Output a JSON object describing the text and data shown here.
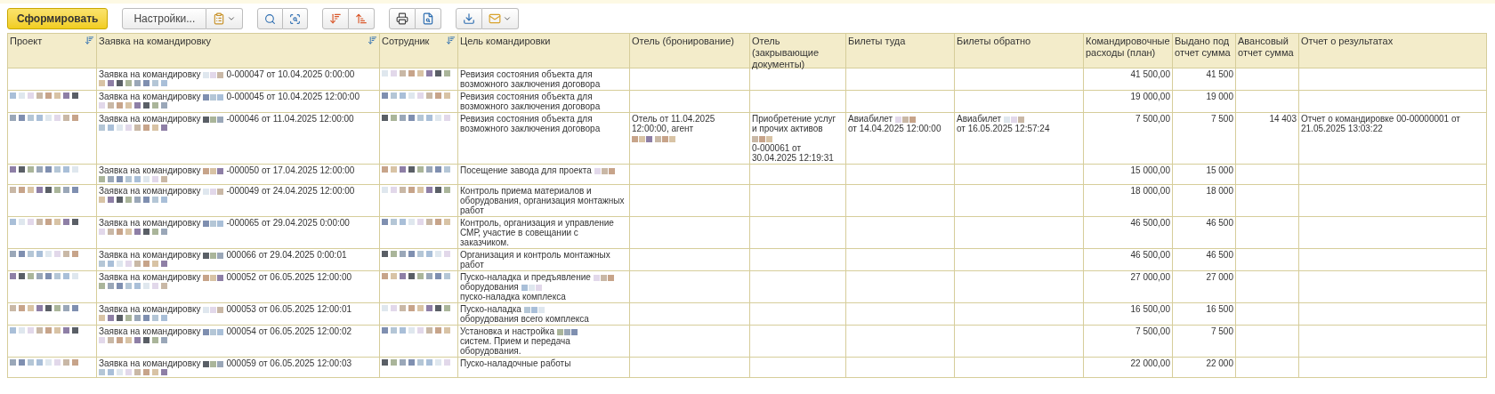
{
  "toolbar": {
    "generate_button": "Сформировать",
    "settings_button": "Настройки..."
  },
  "table": {
    "columns": [
      {
        "label": "Проект",
        "sortable": true
      },
      {
        "label": "Заявка на командировку",
        "sortable": true
      },
      {
        "label": "Сотрудник",
        "sortable": true
      },
      {
        "label": "Цель командировки",
        "sortable": false
      },
      {
        "label": "Отель (бронирование)",
        "sortable": false
      },
      {
        "label": "Отель (закрывающие документы)",
        "sortable": false
      },
      {
        "label": "Билеты туда",
        "sortable": false
      },
      {
        "label": "Билеты обратно",
        "sortable": false
      },
      {
        "label": "Командировочные расходы (план)",
        "sortable": false
      },
      {
        "label": "Выдано под отчет сумма",
        "sortable": false
      },
      {
        "label": "Авансовый отчет сумма",
        "sortable": false
      },
      {
        "label": "Отчет о результатах",
        "sortable": false
      }
    ],
    "rows": [
      {
        "request": [
          "Заявка на командировку",
          {
            "kind": "redacted"
          },
          "0-000047 от 10.04.2025 0:00:00",
          {
            "kind": "redacted_line"
          }
        ],
        "employee": [
          {
            "kind": "redacted_line"
          }
        ],
        "purpose": [
          "Ревизия состояния объекта для возможного заключения договора"
        ],
        "plan": "41 500,00",
        "issued": "41 500"
      },
      {
        "project": [
          {
            "kind": "redacted_line"
          }
        ],
        "request": [
          "Заявка на командировку",
          {
            "kind": "redacted"
          },
          "0-000045 от 10.04.2025 12:00:00",
          {
            "kind": "redacted_line"
          }
        ],
        "employee": [
          {
            "kind": "redacted_line"
          }
        ],
        "purpose": [
          "Ревизия состояния объекта для возможного заключения договора"
        ],
        "plan": "19 000,00",
        "issued": "19 000"
      },
      {
        "project": [
          {
            "kind": "redacted_line"
          }
        ],
        "request": [
          "Заявка на командировку",
          {
            "kind": "redacted"
          },
          "-000046 от 11.04.2025 12:00:00",
          {
            "kind": "redacted_line"
          }
        ],
        "employee": [
          {
            "kind": "redacted_line"
          }
        ],
        "purpose": [
          "Ревизия состояния объекта для возможного заключения договора"
        ],
        "hotel_booking": [
          "Отель  от 11.04.2025 12:00:00, агент",
          {
            "kind": "redacted"
          },
          {
            "kind": "redacted"
          }
        ],
        "hotel_docs": [
          "Приобретение услуг и прочих активов",
          {
            "kind": "redacted"
          },
          "0-000061 от 30.04.2025 12:19:31"
        ],
        "tickets_to": [
          "Авиабилет",
          {
            "kind": "redacted"
          },
          "от 14.04.2025 12:00:00"
        ],
        "tickets_back": [
          "Авиабилет",
          {
            "kind": "redacted"
          },
          "от 16.05.2025 12:57:24"
        ],
        "plan": "7 500,00",
        "issued": "7 500",
        "advance": "14 403",
        "report": [
          "Отчет о командировке 00-00000001 от 21.05.2025 13:03:22"
        ]
      },
      {
        "project": [
          {
            "kind": "redacted_line"
          }
        ],
        "request": [
          "Заявка на командировку",
          {
            "kind": "redacted"
          },
          "-000050 от 17.04.2025 12:00:00",
          {
            "kind": "redacted_line"
          }
        ],
        "employee": [
          {
            "kind": "redacted_line"
          }
        ],
        "purpose": [
          "Посещение завода для проекта",
          {
            "kind": "redacted"
          }
        ],
        "plan": "15 000,00",
        "issued": "15 000"
      },
      {
        "project": [
          {
            "kind": "redacted_line"
          }
        ],
        "request": [
          "Заявка на командировку",
          {
            "kind": "redacted"
          },
          "-000049 от 24.04.2025 12:00:00",
          {
            "kind": "redacted_line"
          }
        ],
        "employee": [
          {
            "kind": "redacted_line"
          }
        ],
        "purpose": [
          "Контроль приема материалов и оборудования, организация монтажных работ"
        ],
        "plan": "18 000,00",
        "issued": "18 000"
      },
      {
        "project": [
          {
            "kind": "redacted_line"
          }
        ],
        "request": [
          "Заявка на командировку",
          {
            "kind": "redacted"
          },
          "-000065 от 29.04.2025 0:00:00",
          {
            "kind": "redacted_line"
          }
        ],
        "employee": [
          {
            "kind": "redacted_line"
          }
        ],
        "purpose": [
          "Контроль, организация и управление СМР, участие в совещании с заказчиком."
        ],
        "plan": "46 500,00",
        "issued": "46 500"
      },
      {
        "project": [
          {
            "kind": "redacted_line"
          }
        ],
        "request": [
          "Заявка на командировку",
          {
            "kind": "redacted"
          },
          "000066 от 29.04.2025 0:00:01",
          {
            "kind": "redacted_line"
          }
        ],
        "employee": [
          {
            "kind": "redacted_line"
          }
        ],
        "purpose": [
          "Организация и контроль монтажных работ"
        ],
        "plan": "46 500,00",
        "issued": "46 500"
      },
      {
        "project": [
          {
            "kind": "redacted_line"
          }
        ],
        "request": [
          "Заявка на командировку",
          {
            "kind": "redacted"
          },
          "000052 от 06.05.2025 12:00:00",
          {
            "kind": "redacted_line"
          }
        ],
        "employee": [
          {
            "kind": "redacted_line"
          }
        ],
        "purpose": [
          "Пуско-наладка и предъявление",
          {
            "kind": "redacted"
          },
          "оборудования",
          {
            "kind": "redacted"
          },
          "пуско-наладка комплекса"
        ],
        "plan": "27 000,00",
        "issued": "27 000"
      },
      {
        "project": [
          {
            "kind": "redacted_line"
          }
        ],
        "request": [
          "Заявка на командировку",
          {
            "kind": "redacted"
          },
          "000053 от 06.05.2025 12:00:01",
          {
            "kind": "redacted_line"
          }
        ],
        "employee": [
          {
            "kind": "redacted_line"
          }
        ],
        "purpose": [
          "Пуско-наладка",
          {
            "kind": "redacted"
          },
          "оборудования всего комплекса"
        ],
        "plan": "16 500,00",
        "issued": "16 500"
      },
      {
        "project": [
          {
            "kind": "redacted_line"
          }
        ],
        "request": [
          "Заявка на командировку",
          {
            "kind": "redacted"
          },
          "000054 от 06.05.2025 12:00:02",
          {
            "kind": "redacted_line"
          }
        ],
        "employee": [
          {
            "kind": "redacted_line"
          }
        ],
        "purpose": [
          "Установка и настройка",
          {
            "kind": "redacted"
          },
          "систем. Прием и передача оборудования."
        ],
        "plan": "7 500,00",
        "issued": "7 500"
      },
      {
        "project": [
          {
            "kind": "redacted_line"
          }
        ],
        "request": [
          "Заявка на командировку",
          {
            "kind": "redacted"
          },
          "000059 от 06.05.2025 12:00:03",
          {
            "kind": "redacted_line"
          }
        ],
        "employee": [
          {
            "kind": "redacted_line"
          }
        ],
        "purpose": [
          "Пуско-наладочные работы"
        ],
        "plan": "22 000,00",
        "issued": "22 000"
      }
    ]
  }
}
